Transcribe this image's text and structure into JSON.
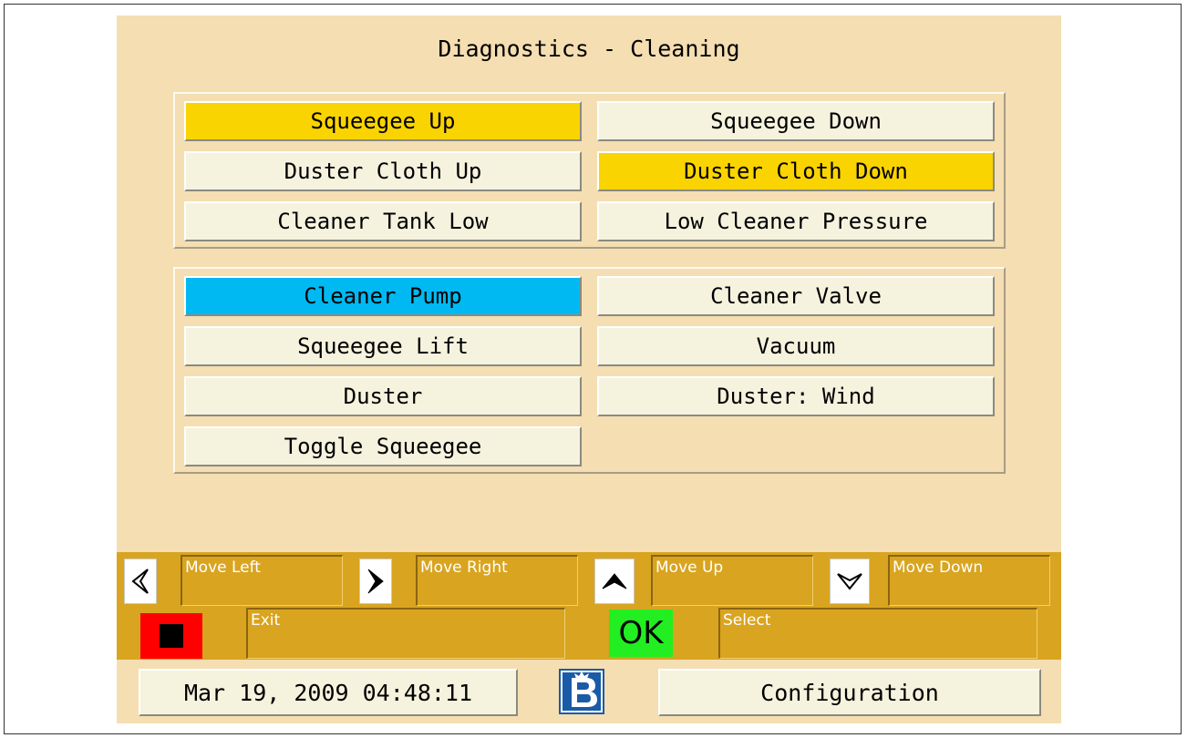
{
  "title": "Diagnostics - Cleaning",
  "status_group": [
    {
      "label": "Squeegee Up",
      "state": "active"
    },
    {
      "label": "Squeegee Down",
      "state": "inactive"
    },
    {
      "label": "Duster Cloth Up",
      "state": "inactive"
    },
    {
      "label": "Duster Cloth Down",
      "state": "active"
    },
    {
      "label": "Cleaner Tank Low",
      "state": "inactive"
    },
    {
      "label": "Low Cleaner Pressure",
      "state": "inactive"
    }
  ],
  "action_group": [
    {
      "label": "Cleaner Pump",
      "state": "selected"
    },
    {
      "label": "Cleaner Valve",
      "state": "inactive"
    },
    {
      "label": "Squeegee Lift",
      "state": "inactive"
    },
    {
      "label": "Vacuum",
      "state": "inactive"
    },
    {
      "label": "Duster",
      "state": "inactive"
    },
    {
      "label": "Duster: Wind",
      "state": "inactive"
    },
    {
      "label": "Toggle Squeegee",
      "state": "inactive"
    }
  ],
  "keys": {
    "left": "Move Left",
    "right": "Move Right",
    "up": "Move Up",
    "down": "Move Down",
    "exit": "Exit",
    "ok_key": "OK",
    "select": "Select"
  },
  "footer": {
    "datetime": "Mar 19, 2009 04:48:11",
    "config_label": "Configuration"
  },
  "colors": {
    "active": "#fad400",
    "selected": "#00b9f2",
    "inactive": "#f5f2de",
    "panel_bg": "#f4deb2",
    "key_bar": "#d9a41f"
  },
  "icons": [
    "arrow-left-icon",
    "arrow-right-icon",
    "arrow-up-icon",
    "arrow-down-icon",
    "stop-icon",
    "brand-logo-icon"
  ]
}
